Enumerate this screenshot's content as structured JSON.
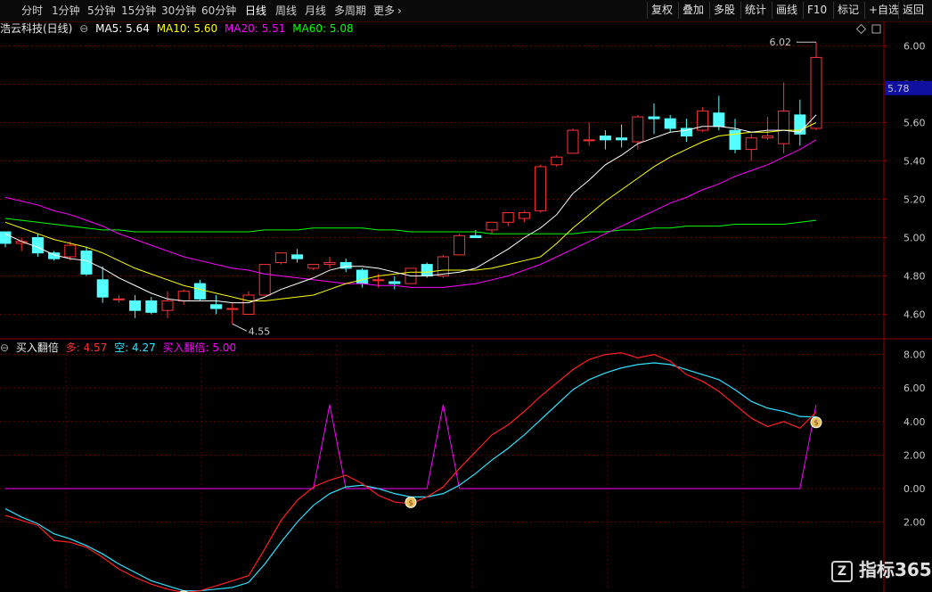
{
  "toolbar": {
    "periods": [
      "分时",
      "1分钟",
      "5分钟",
      "15分钟",
      "30分钟",
      "60分钟",
      "日线",
      "周线",
      "月线",
      "多周期",
      "更多"
    ],
    "active_period": "日线",
    "more_arrow": "chevron-right-icon",
    "right_buttons": [
      "复权",
      "叠加",
      "多股",
      "统计",
      "画线",
      "F10",
      "标记",
      "+自选",
      "返回"
    ]
  },
  "price_panel": {
    "stock": "浩云科技(日线)",
    "ma_labels": [
      {
        "text": "MA5: 5.64",
        "color": "#ffffff"
      },
      {
        "text": "MA10: 5.60",
        "color": "#ffff00"
      },
      {
        "text": "MA20: 5.51",
        "color": "#ff00ff"
      },
      {
        "text": "MA60: 5.08",
        "color": "#00ff00"
      }
    ],
    "y_ticks": [
      "6.00",
      "5.80",
      "5.60",
      "5.40",
      "5.20",
      "5.00",
      "4.80",
      "4.60"
    ],
    "current_price": "5.78",
    "high_label": "6.02",
    "low_label": "4.55"
  },
  "indicator_panel": {
    "name": "买入翻倍",
    "labels": [
      {
        "text": "多: 4.57",
        "color": "#ff3030"
      },
      {
        "text": "空: 4.27",
        "color": "#30e0ff"
      },
      {
        "text": "买入翻倍: 5.00",
        "color": "#ff00ff"
      }
    ],
    "y_ticks": [
      "8.00",
      "6.00",
      "4.00",
      "2.00",
      "0.00",
      "2.00"
    ]
  },
  "watermark": "指标365",
  "colors": {
    "up": "#ff3232",
    "down": "#54ffff",
    "ma5": "#ffffff",
    "ma10": "#ffff00",
    "ma20": "#ff00ff",
    "ma60": "#00ff00",
    "grid": "#6a0000"
  },
  "chart_data": [
    {
      "type": "candlestick",
      "y_range": [
        4.5,
        6.1
      ],
      "ohlc": [
        [
          5.03,
          5.03,
          4.95,
          4.97
        ],
        [
          4.97,
          5.0,
          4.93,
          4.98
        ],
        [
          5.0,
          5.02,
          4.9,
          4.92
        ],
        [
          4.92,
          4.93,
          4.88,
          4.89
        ],
        [
          4.9,
          4.98,
          4.88,
          4.96
        ],
        [
          4.93,
          4.95,
          4.8,
          4.81
        ],
        [
          4.78,
          4.85,
          4.66,
          4.69
        ],
        [
          4.68,
          4.7,
          4.66,
          4.68
        ],
        [
          4.67,
          4.7,
          4.58,
          4.62
        ],
        [
          4.67,
          4.69,
          4.6,
          4.61
        ],
        [
          4.62,
          4.72,
          4.58,
          4.67
        ],
        [
          4.67,
          4.73,
          4.65,
          4.72
        ],
        [
          4.76,
          4.78,
          4.67,
          4.68
        ],
        [
          4.65,
          4.7,
          4.6,
          4.63
        ],
        [
          4.63,
          4.66,
          4.55,
          4.63
        ],
        [
          4.6,
          4.72,
          4.6,
          4.7
        ],
        [
          4.7,
          4.86,
          4.7,
          4.86
        ],
        [
          4.87,
          4.92,
          4.86,
          4.92
        ],
        [
          4.91,
          4.94,
          4.87,
          4.89
        ],
        [
          4.84,
          4.86,
          4.83,
          4.86
        ],
        [
          4.86,
          4.9,
          4.84,
          4.87
        ],
        [
          4.87,
          4.89,
          4.82,
          4.84
        ],
        [
          4.83,
          4.84,
          4.74,
          4.76
        ],
        [
          4.78,
          4.81,
          4.74,
          4.78
        ],
        [
          4.77,
          4.8,
          4.73,
          4.76
        ],
        [
          4.76,
          4.84,
          4.76,
          4.84
        ],
        [
          4.86,
          4.87,
          4.79,
          4.8
        ],
        [
          4.8,
          4.91,
          4.79,
          4.9
        ],
        [
          4.91,
          5.02,
          4.91,
          5.01
        ],
        [
          5.01,
          5.04,
          5.0,
          5.0
        ],
        [
          5.04,
          5.08,
          5.02,
          5.08
        ],
        [
          5.08,
          5.13,
          5.06,
          5.13
        ],
        [
          5.1,
          5.14,
          5.08,
          5.13
        ],
        [
          5.14,
          5.38,
          5.13,
          5.37
        ],
        [
          5.38,
          5.43,
          5.37,
          5.42
        ],
        [
          5.44,
          5.57,
          5.44,
          5.56
        ],
        [
          5.51,
          5.6,
          5.48,
          5.51
        ],
        [
          5.53,
          5.56,
          5.46,
          5.51
        ],
        [
          5.52,
          5.59,
          5.47,
          5.51
        ],
        [
          5.5,
          5.64,
          5.46,
          5.63
        ],
        [
          5.63,
          5.7,
          5.54,
          5.62
        ],
        [
          5.62,
          5.64,
          5.55,
          5.57
        ],
        [
          5.57,
          5.62,
          5.5,
          5.53
        ],
        [
          5.56,
          5.68,
          5.55,
          5.66
        ],
        [
          5.65,
          5.74,
          5.56,
          5.58
        ],
        [
          5.56,
          5.62,
          5.44,
          5.46
        ],
        [
          5.46,
          5.54,
          5.4,
          5.52
        ],
        [
          5.52,
          5.63,
          5.51,
          5.53
        ],
        [
          5.49,
          5.81,
          5.44,
          5.66
        ],
        [
          5.64,
          5.72,
          5.48,
          5.54
        ],
        [
          5.57,
          6.02,
          5.56,
          5.94
        ]
      ],
      "ma5": [
        5.02,
        4.98,
        4.95,
        4.91,
        4.89,
        4.88,
        4.84,
        4.79,
        4.75,
        4.71,
        4.68,
        4.67,
        4.67,
        4.67,
        4.66,
        4.66,
        4.69,
        4.73,
        4.76,
        4.79,
        4.83,
        4.85,
        4.85,
        4.84,
        4.82,
        4.8,
        4.8,
        4.81,
        4.82,
        4.84,
        4.89,
        4.94,
        5.0,
        5.05,
        5.12,
        5.23,
        5.3,
        5.38,
        5.43,
        5.49,
        5.52,
        5.55,
        5.56,
        5.58,
        5.58,
        5.57,
        5.55,
        5.56,
        5.56,
        5.55,
        5.64
      ],
      "ma10": [
        5.08,
        5.05,
        5.02,
        4.99,
        4.97,
        4.95,
        4.92,
        4.88,
        4.84,
        4.81,
        4.78,
        4.75,
        4.73,
        4.71,
        4.69,
        4.67,
        4.67,
        4.68,
        4.69,
        4.7,
        4.73,
        4.76,
        4.78,
        4.8,
        4.81,
        4.82,
        4.82,
        4.83,
        4.83,
        4.83,
        4.84,
        4.86,
        4.88,
        4.9,
        4.97,
        5.05,
        5.12,
        5.19,
        5.25,
        5.31,
        5.37,
        5.42,
        5.46,
        5.5,
        5.53,
        5.54,
        5.55,
        5.55,
        5.56,
        5.56,
        5.6
      ],
      "ma20": [
        5.21,
        5.19,
        5.17,
        5.14,
        5.12,
        5.09,
        5.06,
        5.02,
        4.99,
        4.96,
        4.93,
        4.9,
        4.88,
        4.86,
        4.84,
        4.83,
        4.81,
        4.8,
        4.79,
        4.78,
        4.77,
        4.76,
        4.76,
        4.75,
        4.75,
        4.74,
        4.74,
        4.74,
        4.75,
        4.76,
        4.78,
        4.8,
        4.83,
        4.86,
        4.9,
        4.94,
        4.98,
        5.02,
        5.06,
        5.1,
        5.14,
        5.18,
        5.21,
        5.25,
        5.28,
        5.32,
        5.35,
        5.38,
        5.42,
        5.46,
        5.51
      ],
      "ma60": [
        5.1,
        5.09,
        5.08,
        5.07,
        5.06,
        5.05,
        5.04,
        5.04,
        5.03,
        5.03,
        5.03,
        5.03,
        5.03,
        5.03,
        5.03,
        5.03,
        5.04,
        5.04,
        5.04,
        5.05,
        5.05,
        5.05,
        5.05,
        5.04,
        5.04,
        5.03,
        5.03,
        5.03,
        5.03,
        5.03,
        5.02,
        5.02,
        5.02,
        5.02,
        5.02,
        5.02,
        5.03,
        5.03,
        5.04,
        5.04,
        5.05,
        5.05,
        5.06,
        5.06,
        5.06,
        5.07,
        5.07,
        5.07,
        5.07,
        5.08,
        5.09
      ]
    },
    {
      "type": "line",
      "y_range": [
        -3,
        9
      ],
      "series": [
        {
          "name": "多",
          "values": [
            -1.6,
            -1.9,
            -2.2,
            -3.1,
            -3.2,
            -3.5,
            -4.1,
            -4.8,
            -5.3,
            -5.7,
            -6.0,
            -6.2,
            -6.1,
            -5.8,
            -5.5,
            -5.2,
            -3.6,
            -1.9,
            -0.7,
            0.1,
            0.5,
            0.8,
            0.3,
            -0.4,
            -0.8,
            -0.9,
            -0.5,
            0.1,
            1.2,
            2.2,
            3.2,
            3.8,
            4.6,
            5.5,
            6.3,
            7.1,
            7.7,
            8.0,
            8.1,
            7.8,
            8.0,
            7.6,
            6.8,
            6.4,
            5.8,
            5.0,
            4.2,
            3.7,
            4.0,
            3.6,
            4.57
          ]
        },
        {
          "name": "空",
          "values": [
            -1.2,
            -1.7,
            -2.1,
            -2.7,
            -3.0,
            -3.4,
            -3.9,
            -4.5,
            -5.0,
            -5.5,
            -5.8,
            -6.1,
            -6.1,
            -6.0,
            -5.9,
            -5.6,
            -4.5,
            -3.2,
            -2.0,
            -1.0,
            -0.3,
            0.1,
            0.2,
            0.0,
            -0.3,
            -0.5,
            -0.5,
            -0.3,
            0.2,
            0.9,
            1.7,
            2.4,
            3.2,
            4.1,
            5.0,
            5.9,
            6.5,
            6.9,
            7.2,
            7.4,
            7.5,
            7.4,
            7.1,
            6.8,
            6.5,
            5.9,
            5.2,
            4.8,
            4.6,
            4.3,
            4.27
          ]
        },
        {
          "name": "买入翻倍",
          "values": [
            0,
            0,
            0,
            0,
            0,
            0,
            0,
            0,
            0,
            0,
            0,
            0,
            0,
            0,
            0,
            0,
            0,
            0,
            0,
            0,
            5,
            0,
            0,
            0,
            0,
            0,
            0,
            5,
            0,
            0,
            0,
            0,
            0,
            0,
            0,
            0,
            0,
            0,
            0,
            0,
            0,
            0,
            0,
            0,
            0,
            0,
            0,
            0,
            0,
            0,
            5
          ]
        }
      ],
      "buy_signals": [
        11,
        25,
        50
      ]
    }
  ]
}
